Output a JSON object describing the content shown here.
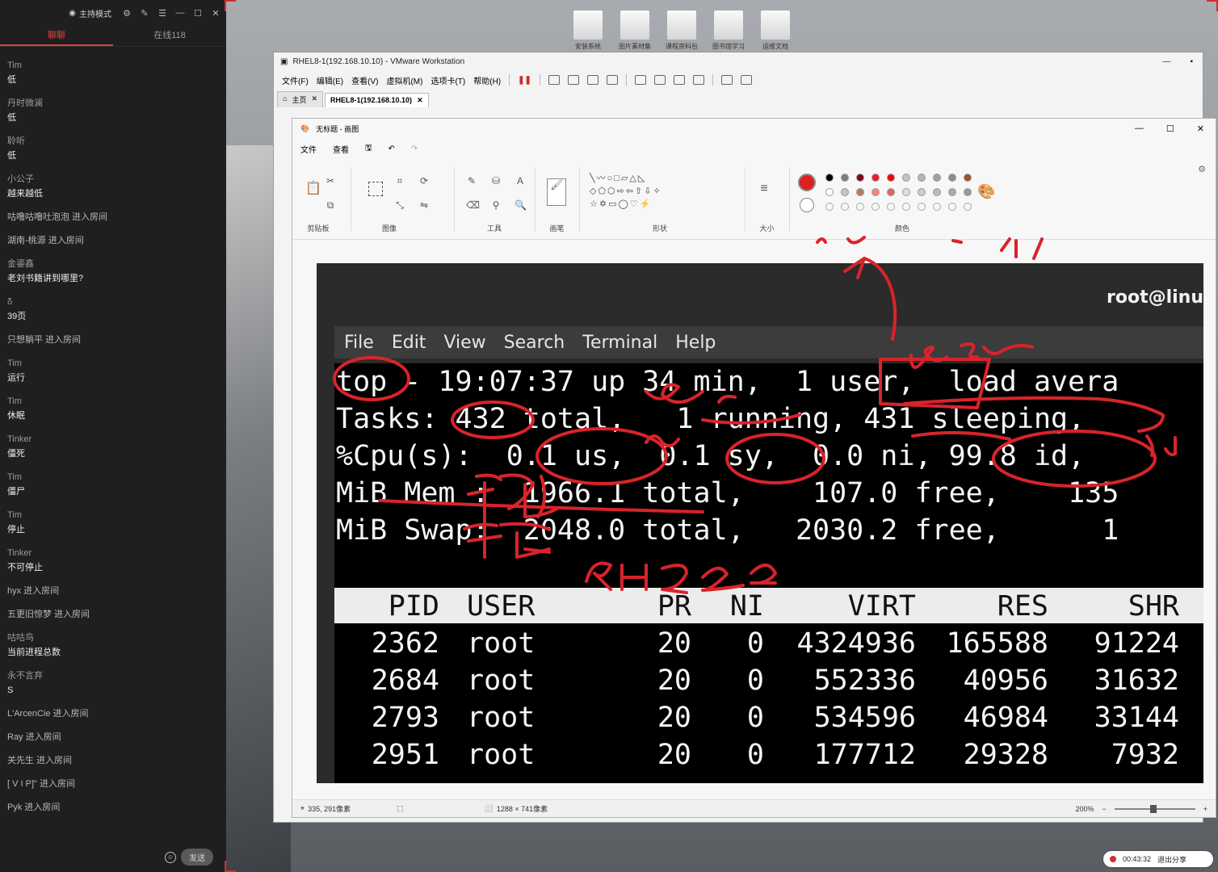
{
  "sidebar": {
    "mode_label": "主持模式",
    "tabs": {
      "chat": "聊聊",
      "online": "在线118"
    },
    "messages": [
      {
        "who": "Tim",
        "text": "低"
      },
      {
        "who": "丹时微澜",
        "text": "低"
      },
      {
        "who": "聆听",
        "text": "低"
      },
      {
        "who": "小公子",
        "text": "越来越低"
      },
      {
        "single": "咕噜咕噜吐泡泡 进入房间"
      },
      {
        "single": "湖南-桃源 进入房间"
      },
      {
        "who": "金鎏鑫",
        "text": "老刘书籍讲到哪里?"
      },
      {
        "who": "δ",
        "text": "39页"
      },
      {
        "single": "只想躺平 进入房间"
      },
      {
        "who": "Tim",
        "text": "运行"
      },
      {
        "who": "Tim",
        "text": "休眠"
      },
      {
        "who": "Tinker",
        "text": "僵死"
      },
      {
        "who": "Tim",
        "text": "僵尸"
      },
      {
        "who": "Tim",
        "text": "停止"
      },
      {
        "who": "Tinker",
        "text": "不可停止"
      },
      {
        "single": "hyx 进入房间"
      },
      {
        "single": "五更旧惊梦 进入房间"
      },
      {
        "who": "咕咕鸟",
        "text": "当前进程总数"
      },
      {
        "who": "永不言弃",
        "text": "S"
      },
      {
        "single": "L'ArcenCie 进入房间"
      },
      {
        "single": "Ray 进入房间"
      },
      {
        "single": "关先生 进入房间"
      },
      {
        "single": "[ V I P]\" 进入房间"
      },
      {
        "single": "Pyk 进入房间"
      }
    ],
    "send_label": "发送"
  },
  "desktop_icons": [
    "安装系统",
    "图片素材集",
    "课程资料包",
    "图书馆学习",
    "运维文档"
  ],
  "vmware": {
    "title": "RHEL8-1(192.168.10.10) - VMware Workstation",
    "menu": [
      "文件(F)",
      "编辑(E)",
      "查看(V)",
      "虚拟机(M)",
      "选项卡(T)",
      "帮助(H)"
    ],
    "tabs": [
      {
        "label": "主页"
      },
      {
        "label": "RHEL8-1(192.168.10.10)"
      }
    ]
  },
  "paint": {
    "title": "无标题 - 画图",
    "menu": [
      "文件",
      "查看"
    ],
    "groups": [
      "剪贴板",
      "图像",
      "工具",
      "画笔",
      "形状",
      "大小",
      "颜色"
    ],
    "palette_row1": [
      "#000000",
      "#7f7f7f",
      "#880015",
      "#ed1c24",
      "#ff0000",
      "#c3c3c3",
      "#b4b4b4",
      "#a0a0a0",
      "#8c8c8c",
      "#a0522d"
    ],
    "palette_row2": [
      "#ffffff",
      "#c3c3c3",
      "#b97a57",
      "#ff7f7f",
      "#e06666",
      "#dddddd",
      "#cccccc",
      "#bbbbbb",
      "#aaaaaa",
      "#999999"
    ],
    "status": {
      "cursor": "335, 291像素",
      "size": "1288 × 741像素",
      "zoom": "200%"
    }
  },
  "terminal": {
    "title": "root@linu",
    "menu": [
      "File",
      "Edit",
      "View",
      "Search",
      "Terminal",
      "Help"
    ],
    "lines": [
      "top - 19:07:37 up 34 min,  1 user,  load avera",
      "Tasks: 432 total,   1 running, 431 sleeping,",
      "%Cpu(s):  0.1 us,  0.1 sy,  0.0 ni, 99.8 id,",
      "MiB Mem :  1966.1 total,    107.0 free,    135",
      "MiB Swap:  2048.0 total,   2030.2 free,      1"
    ],
    "headers": [
      "PID",
      "USER",
      "PR",
      "NI",
      "VIRT",
      "RES",
      "SHR"
    ],
    "rows": [
      [
        "2362",
        "root",
        "20",
        "0",
        "4324936",
        "165588",
        "91224"
      ],
      [
        "2684",
        "root",
        "20",
        "0",
        "552336",
        "40956",
        "31632"
      ],
      [
        "2793",
        "root",
        "20",
        "0",
        "534596",
        "46984",
        "33144"
      ],
      [
        "2951",
        "root",
        "20",
        "0",
        "177712",
        "29328",
        "7932"
      ]
    ]
  },
  "recording": {
    "time": "00:43:32",
    "exit": "退出分享"
  }
}
